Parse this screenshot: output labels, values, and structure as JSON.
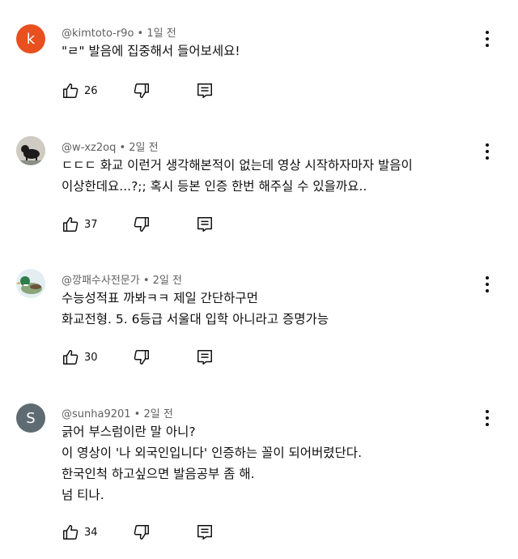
{
  "comments": [
    {
      "avatar_letter": "k",
      "avatar_color": "#e8511f",
      "author": "@kimtoto-r9o",
      "time": "1일 전",
      "lines": [
        "\"ㄹ\" 발음에 집중해서 들어보세요!"
      ],
      "likes": "26",
      "icons": [
        "like-icon",
        "dislike-icon",
        "reply-icon",
        "more-icon"
      ]
    },
    {
      "avatar_type": "photo-dog",
      "author": "@w-xz2oq",
      "time": "2일 전",
      "lines": [
        "ㄷㄷㄷ 화교 이런거 생각해본적이 없는데 영상 시작하자마자 발음이",
        "이상한데요...?;; 혹시 등본 인증 한번 해주실 수 있을까요.."
      ],
      "likes": "37"
    },
    {
      "avatar_type": "photo-duck",
      "author": "@깡패수사전문가",
      "time": "2일 전",
      "lines": [
        "수능성적표 까봐ㅋㅋ 제일 간단하구먼",
        "화교전형. 5. 6등급 서울대 입학 아니라고 증명가능"
      ],
      "likes": "30"
    },
    {
      "avatar_letter": "S",
      "avatar_color": "#5f6b73",
      "author": "@sunha9201",
      "time": "2일 전",
      "lines": [
        "긁어 부스럼이란 말 아니?",
        "이 영상이 '나 외국인입니다' 인증하는 꼴이 되어버렸단다.",
        "한국인척 하고싶으면 발음공부 좀 해.",
        "넘 티나."
      ],
      "likes": "34"
    }
  ],
  "separator": " • "
}
